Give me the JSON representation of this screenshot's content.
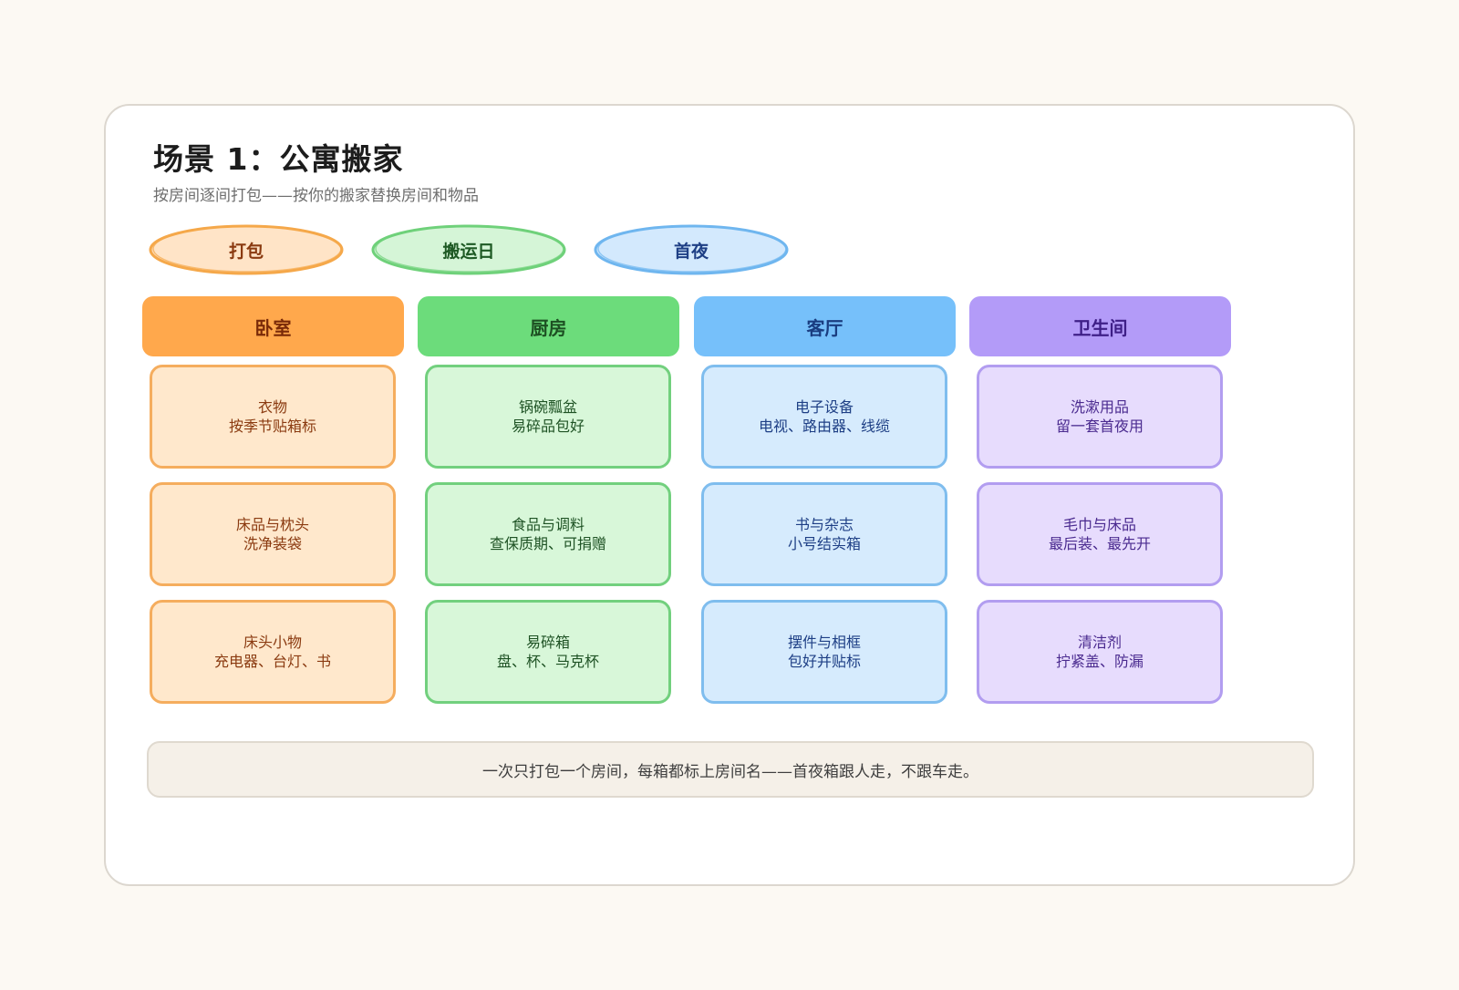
{
  "title": "场景 1：公寓搬家",
  "subtitle": "按房间逐间打包——按你的搬家替换房间和物品",
  "phases": [
    {
      "label": "打包",
      "fill": "#ffe4c7",
      "stroke": "#f5a84a",
      "text": "#8a3a10"
    },
    {
      "label": "搬运日",
      "fill": "#d5f5d7",
      "stroke": "#6fd17a",
      "text": "#1e5a24"
    },
    {
      "label": "首夜",
      "fill": "#d3e9fd",
      "stroke": "#6fb6ef",
      "text": "#1e3f85"
    }
  ],
  "rooms": [
    {
      "name": "卧室",
      "header_bg": "#ffa84c",
      "header_text": "#7a2a08",
      "box_bg": "#ffe8cc",
      "box_border": "#f5ad5e",
      "box_text": "#8a3a10",
      "items": [
        {
          "title": "衣物",
          "note": "按季节贴箱标"
        },
        {
          "title": "床品与枕头",
          "note": "洗净装袋"
        },
        {
          "title": "床头小物",
          "note": "充电器、台灯、书"
        }
      ]
    },
    {
      "name": "厨房",
      "header_bg": "#6cdc7b",
      "header_text": "#1d4f22",
      "box_bg": "#d8f7d9",
      "box_border": "#72d07e",
      "box_text": "#1e5224",
      "items": [
        {
          "title": "锅碗瓢盆",
          "note": "易碎品包好"
        },
        {
          "title": "食品与调料",
          "note": "查保质期、可捐赠"
        },
        {
          "title": "易碎箱",
          "note": "盘、杯、马克杯"
        }
      ]
    },
    {
      "name": "客厅",
      "header_bg": "#76c0fa",
      "header_text": "#1a3d80",
      "box_bg": "#d6ebfd",
      "box_border": "#7fbdee",
      "box_text": "#1e3f85",
      "items": [
        {
          "title": "电子设备",
          "note": "电视、路由器、线缆"
        },
        {
          "title": "书与杂志",
          "note": "小号结实箱"
        },
        {
          "title": "摆件与相框",
          "note": "包好并贴标"
        }
      ]
    },
    {
      "name": "卫生间",
      "header_bg": "#b39bf8",
      "header_text": "#3e1f87",
      "box_bg": "#e7dcfd",
      "box_border": "#b29df0",
      "box_text": "#4a2a8f",
      "items": [
        {
          "title": "洗漱用品",
          "note": "留一套首夜用"
        },
        {
          "title": "毛巾与床品",
          "note": "最后装、最先开"
        },
        {
          "title": "清洁剂",
          "note": "拧紧盖、防漏"
        }
      ]
    }
  ],
  "footer_note": "一次只打包一个房间，每箱都标上房间名——首夜箱跟人走，不跟车走。"
}
